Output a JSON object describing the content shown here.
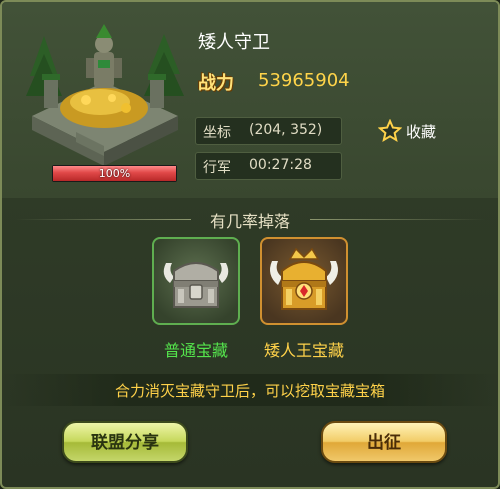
{
  "target": {
    "name": "矮人守卫",
    "power_label": "战力",
    "power_value": "53965904",
    "hp_text": "100%",
    "hp_fraction": 1.0,
    "coord_label": "坐标",
    "coord_value": "(204, 352)",
    "march_label": "行军",
    "march_value": "00:27:28",
    "favorite_label": "收藏"
  },
  "drops": {
    "title": "有几率掉落",
    "items": [
      {
        "name": "普通宝藏",
        "icon": "common-treasure-chest-icon",
        "rarity_color": "#54e44c"
      },
      {
        "name": "矮人王宝藏",
        "icon": "dwarf-king-treasure-chest-icon",
        "rarity_color": "#ffd24a"
      }
    ]
  },
  "hint": "合力消灭宝藏守卫后，可以挖取宝藏宝箱",
  "buttons": {
    "share": "联盟分享",
    "march": "出征"
  },
  "colors": {
    "power": "#ffd44a",
    "hint": "#ffd24a",
    "hp_bar": "#e04848"
  }
}
